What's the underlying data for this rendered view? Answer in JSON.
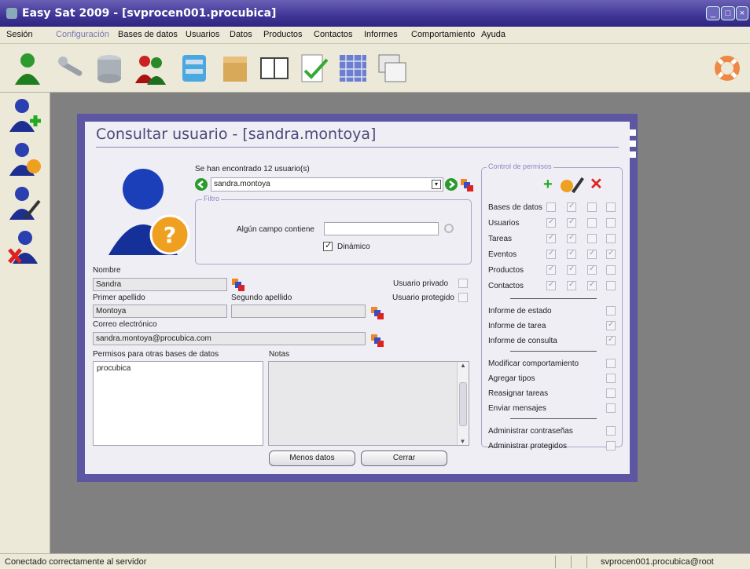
{
  "window": {
    "title": "Easy Sat 2009 - [svprocen001.procubica]"
  },
  "menu": [
    "Sesión",
    "Configuración",
    "Bases de datos",
    "Usuarios",
    "Datos",
    "Productos",
    "Contactos",
    "Informes",
    "Comportamiento",
    "Ayuda"
  ],
  "dialog": {
    "title": "Consultar usuario - [sandra.montoya]",
    "found_text": "Se han encontrado 12 usuario(s)",
    "selected_user": "sandra.montoya",
    "filter": {
      "group": "Filtro",
      "field_label": "Algún campo contiene",
      "field_value": "",
      "dynamic_label": "Dinámico",
      "dynamic_checked": true
    },
    "nombre_label": "Nombre",
    "nombre": "Sandra",
    "primer_label": "Primer apellido",
    "primer": "Montoya",
    "segundo_label": "Segundo apellido",
    "segundo": "",
    "correo_label": "Correo electrónico",
    "correo": "sandra.montoya@procubica.com",
    "privado_label": "Usuario privado",
    "protegido_label": "Usuario protegido",
    "permisos_label": "Permisos para otras bases de datos",
    "permisos_items": [
      "procubica"
    ],
    "notas_label": "Notas",
    "notas": "",
    "btn_menos": "Menos datos",
    "btn_cerrar": "Cerrar",
    "control": {
      "title": "Control de permisos",
      "rows": [
        {
          "label": "Bases de datos",
          "checks": [
            false,
            true,
            false,
            false
          ]
        },
        {
          "label": "Usuarios",
          "checks": [
            true,
            true,
            false,
            false
          ]
        },
        {
          "label": "Tareas",
          "checks": [
            true,
            true,
            false,
            false
          ]
        },
        {
          "label": "Eventos",
          "checks": [
            true,
            true,
            true,
            true
          ]
        },
        {
          "label": "Productos",
          "checks": [
            true,
            true,
            true,
            false
          ]
        },
        {
          "label": "Contactos",
          "checks": [
            true,
            true,
            true,
            false
          ]
        }
      ],
      "informes": [
        {
          "label": "Informe de estado",
          "checked": false
        },
        {
          "label": "Informe de tarea",
          "checked": true
        },
        {
          "label": "Informe de consulta",
          "checked": true
        }
      ],
      "otros": [
        {
          "label": "Modificar comportamiento",
          "checked": false
        },
        {
          "label": "Agregar tipos",
          "checked": false
        },
        {
          "label": "Reasignar tareas",
          "checked": false
        },
        {
          "label": "Enviar mensajes",
          "checked": false
        }
      ],
      "admin": [
        {
          "label": "Administrar contraseñas",
          "checked": false
        },
        {
          "label": "Administrar protegidos",
          "checked": false
        }
      ]
    }
  },
  "status": {
    "left": "Conectado correctamente al servidor",
    "right": "svprocen001.procubica@root"
  }
}
